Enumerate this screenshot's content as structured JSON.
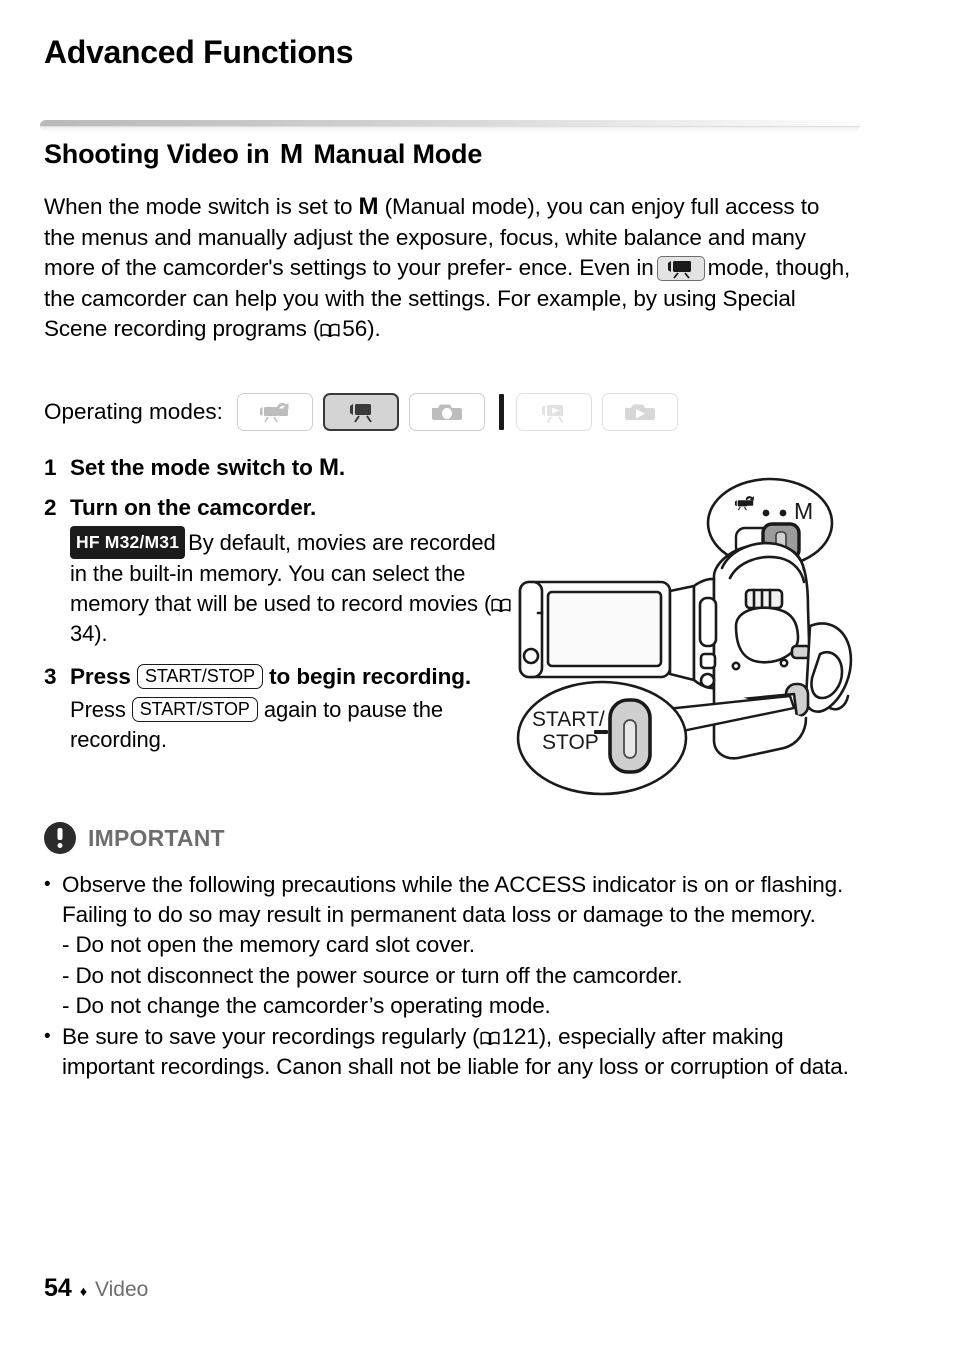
{
  "chapter": {
    "title": "Advanced Functions"
  },
  "section": {
    "title_pre": "Shooting Video in",
    "title_glyph": "M",
    "title_post": "Manual Mode"
  },
  "intro": {
    "t1": "When the mode switch is set to",
    "glyph1": "M",
    "t2": "(Manual mode), you can enjoy full access to the menus and manually adjust the exposure, focus, white balance and many more of the camcorder's settings to your prefer-",
    "t3": "ence. Even in",
    "t4": "mode, though, the camcorder can help you with the settings. For example, by using Special Scene recording programs",
    "t5_open": "(",
    "page_ref": "56",
    "t5_close": ")."
  },
  "operating_modes": {
    "label": "Operating modes:",
    "items": [
      {
        "name": "auto-camcorder-mode",
        "icon": "camcorder-auto-icon",
        "state": "available"
      },
      {
        "name": "manual-camcorder-mode",
        "icon": "camcorder-icon",
        "state": "active"
      },
      {
        "name": "photo-camera-mode",
        "icon": "camera-icon",
        "state": "available"
      },
      {
        "name": "movie-playback-mode",
        "icon": "camcorder-playback-icon",
        "state": "dimmed"
      },
      {
        "name": "photo-playback-mode",
        "icon": "camera-playback-icon",
        "state": "dimmed"
      }
    ]
  },
  "steps": [
    {
      "num": "1",
      "head_pre": "Set the mode switch to",
      "head_glyph": "M",
      "head_post": ".",
      "sub": ""
    },
    {
      "num": "2",
      "head_pre": "Turn on the camcorder.",
      "head_glyph": "",
      "head_post": "",
      "badge": "HF M32/M31",
      "sub_a": "By default, movies are recorded in the built-in memory. You can select the memory that will be used to record movies (",
      "page_ref": "34",
      "sub_b": ")."
    },
    {
      "num": "3",
      "head_pre": "Press",
      "key": "START/STOP",
      "head_post": "to begin recording.",
      "sub_a": "Press",
      "key2": "START/STOP",
      "sub_b": "again to pause the recording."
    }
  ],
  "illustration": {
    "mode_switch_callout": {
      "auto_icon": "camcorder-auto-icon",
      "dots": ". .",
      "manual_label": "M"
    },
    "start_stop_callout": {
      "line1": "START/",
      "line2": "STOP"
    }
  },
  "important": {
    "title": "IMPORTANT",
    "bullets": [
      {
        "text": "Observe the following precautions while the ACCESS indicator is on or flashing. Failing to do so may result in permanent data loss or damage to the memory.",
        "subitems": [
          "- Do not open the memory card slot cover.",
          "- Do not disconnect the power source or turn off the camcorder.",
          "- Do not change the camcorder’s operating mode."
        ]
      },
      {
        "text_a": "Be sure to save your recordings regularly (",
        "page_ref": "121",
        "text_b": "), especially after making important recordings. Canon shall not be liable for any loss or corruption of data.",
        "subitems": []
      }
    ]
  },
  "footer": {
    "page_number": "54",
    "diamond": "♦",
    "section_name": "Video"
  }
}
